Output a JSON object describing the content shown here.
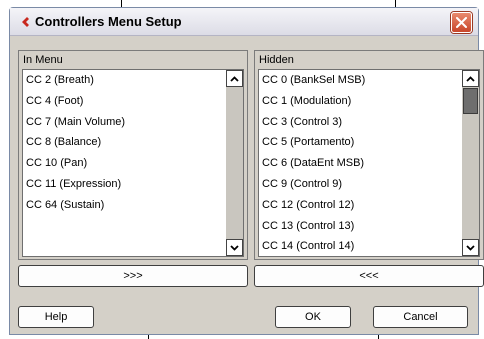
{
  "window": {
    "title": "Controllers Menu Setup",
    "close_icon": "close-x-icon",
    "app_icon": "cubase-logo-icon"
  },
  "in_menu": {
    "label": "In Menu",
    "items": [
      "CC 2  (Breath)",
      "CC 4  (Foot)",
      "CC 7  (Main Volume)",
      "CC 8  (Balance)",
      "CC 10  (Pan)",
      "CC 11  (Expression)",
      "CC 64  (Sustain)"
    ]
  },
  "hidden": {
    "label": "Hidden",
    "items": [
      "CC 0  (BankSel MSB)",
      "CC 1  (Modulation)",
      "CC 3  (Control 3)",
      "CC 5  (Portamento)",
      "CC 6  (DataEnt MSB)",
      "CC 9  (Control 9)",
      "CC 12  (Control 12)",
      "CC 13  (Control 13)",
      "CC 14  (Control 14)"
    ]
  },
  "buttons": {
    "move_to_hidden": ">>>",
    "move_to_menu": "<<<",
    "help": "Help",
    "ok": "OK",
    "cancel": "Cancel"
  },
  "colors": {
    "dialog_bg": "#d4d0c8",
    "close_button": "#c8462a",
    "app_icon": "#c8281e"
  }
}
